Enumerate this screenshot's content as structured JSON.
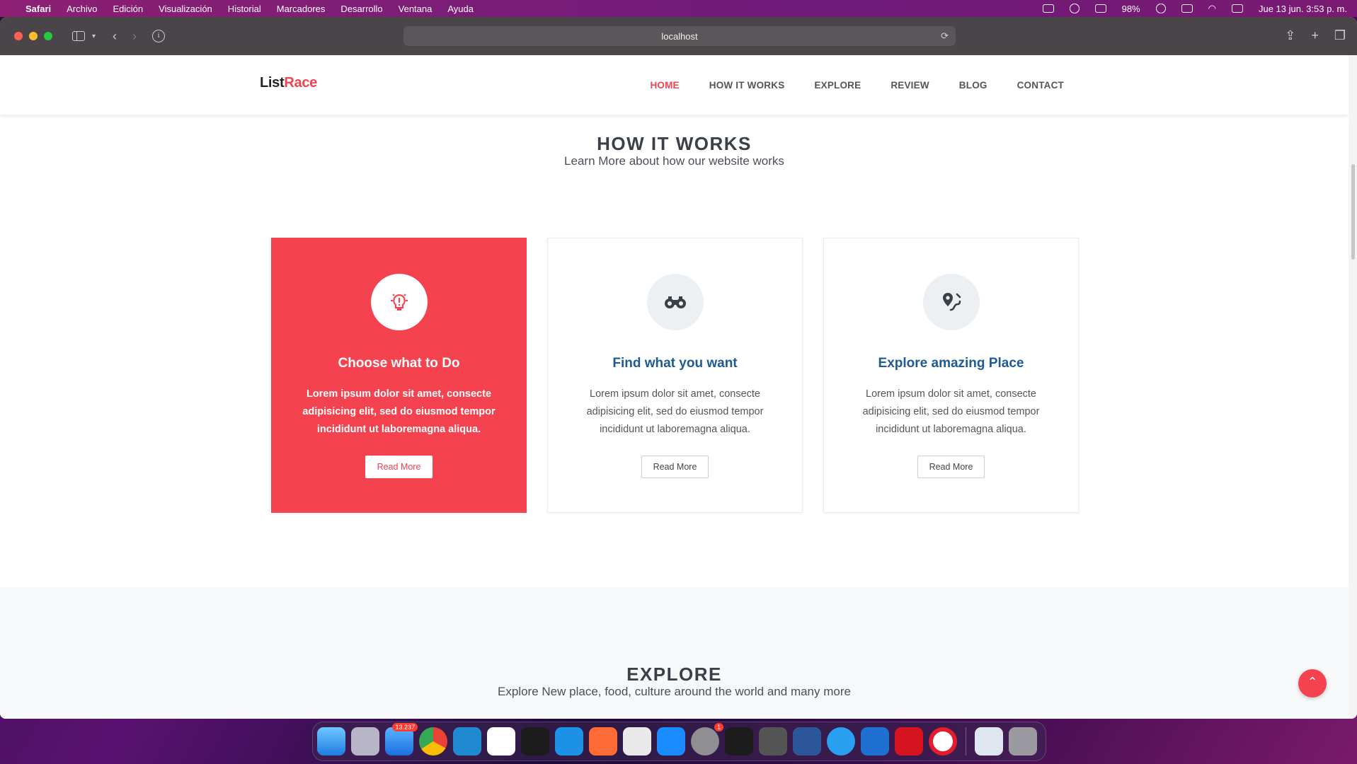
{
  "menubar": {
    "app": "Safari",
    "items": [
      "Archivo",
      "Edición",
      "Visualización",
      "Historial",
      "Marcadores",
      "Desarrollo",
      "Ventana",
      "Ayuda"
    ],
    "battery": "98%",
    "datetime": "Jue 13 jun.  3:53 p. m."
  },
  "browser": {
    "url": "localhost"
  },
  "site": {
    "logo_part1": "List",
    "logo_part2": "Race",
    "nav": [
      "HOME",
      "HOW IT WORKS",
      "EXPLORE",
      "REVIEW",
      "BLOG",
      "CONTACT"
    ],
    "active_nav": "HOME"
  },
  "how_it_works": {
    "title": "HOW IT WORKS",
    "subtitle": "Learn More about how our website works",
    "cards": [
      {
        "icon": "lightbulb-icon",
        "title": "Choose what to Do",
        "text": "Lorem ipsum dolor sit amet, consecte adipisicing elit, sed do eiusmod tempor incididunt ut laboremagna aliqua.",
        "button": "Read More"
      },
      {
        "icon": "binoculars-icon",
        "title": "Find what you want",
        "text": "Lorem ipsum dolor sit amet, consecte adipisicing elit, sed do eiusmod tempor incididunt ut laboremagna aliqua.",
        "button": "Read More"
      },
      {
        "icon": "map-route-icon",
        "title": "Explore amazing Place",
        "text": "Lorem ipsum dolor sit amet, consecte adipisicing elit, sed do eiusmod tempor incididunt ut laboremagna aliqua.",
        "button": "Read More"
      }
    ]
  },
  "explore": {
    "title": "EXPLORE",
    "subtitle": "Explore New place, food, culture around the world and many more"
  },
  "dock": {
    "mail_badge": "13.237",
    "settings_badge": "1"
  },
  "colors": {
    "accent": "#f5424f",
    "heading": "#1e5a93",
    "menubar": "#7a1a72"
  }
}
